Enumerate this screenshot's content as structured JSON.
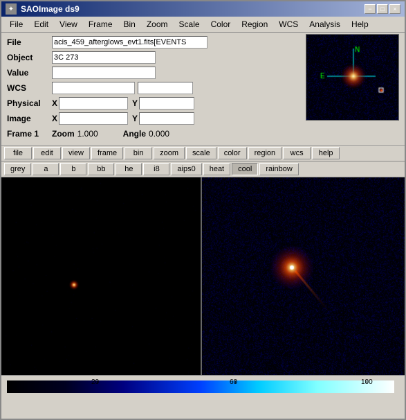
{
  "window": {
    "title": "SAOImage ds9",
    "icon": "★"
  },
  "titlebar": {
    "minimize": "−",
    "maximize": "□",
    "close": "×"
  },
  "menubar": {
    "items": [
      "File",
      "Edit",
      "View",
      "Frame",
      "Bin",
      "Zoom",
      "Scale",
      "Color",
      "Region",
      "WCS",
      "Analysis",
      "Help"
    ]
  },
  "info": {
    "file_label": "File",
    "file_value": "acis_459_afterglows_evt1.fits[EVENTS",
    "object_label": "Object",
    "object_value": "3C 273",
    "value_label": "Value",
    "value_value": "",
    "wcs_label": "WCS",
    "wcs_value": "",
    "wcs_value2": "",
    "physical_label": "Physical",
    "physical_x_label": "X",
    "physical_x_value": "",
    "physical_y_label": "Y",
    "physical_y_value": "",
    "image_label": "Image",
    "image_x_label": "X",
    "image_x_value": "",
    "image_y_label": "Y",
    "image_y_value": "",
    "frame_label": "Frame 1",
    "zoom_label": "Zoom",
    "zoom_value": "1.000",
    "angle_label": "Angle",
    "angle_value": "0.000"
  },
  "toolbar": {
    "items": [
      "file",
      "edit",
      "view",
      "frame",
      "bin",
      "zoom",
      "scale",
      "color",
      "region",
      "wcs",
      "help"
    ]
  },
  "colormap": {
    "items": [
      "grey",
      "a",
      "b",
      "bb",
      "he",
      "i8",
      "aips0",
      "heat",
      "cool",
      "rainbow"
    ],
    "active": "cool"
  },
  "bottom": {
    "scale_20": "20",
    "scale_60": "60",
    "scale_100": "100"
  }
}
